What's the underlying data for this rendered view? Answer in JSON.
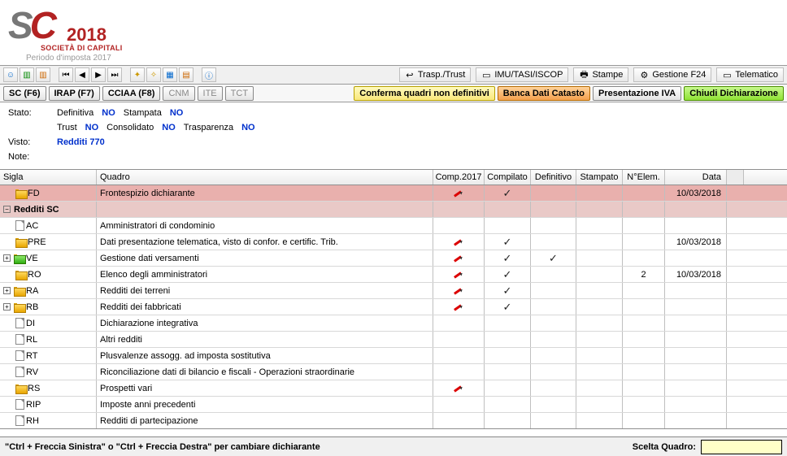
{
  "header": {
    "year": "2018",
    "subtitle": "SOCIETÀ DI CAPITALI",
    "period": "Periodo d'imposta 2017"
  },
  "toolbar1": {
    "trasp_trust": "Trasp./Trust",
    "imu": "IMU/TASI/ISCOP",
    "stampe": "Stampe",
    "gestione": "Gestione F24",
    "telematico": "Telematico"
  },
  "tabbar": {
    "sc": "SC (F6)",
    "irap": "IRAP (F7)",
    "cciaa": "CCIAA (F8)",
    "cnm": "CNM",
    "ite": "ITE",
    "tct": "TCT",
    "conferma": "Conferma quadri non definitivi",
    "banca": "Banca Dati Catasto",
    "pres_iva": "Presentazione IVA",
    "chiudi": "Chiudi Dichiarazione"
  },
  "info": {
    "stato_label": "Stato:",
    "definitiva": "Definitiva",
    "definitiva_v": "NO",
    "stampata": "Stampata",
    "stampata_v": "NO",
    "trust": "Trust",
    "trust_v": "NO",
    "consolidato": "Consolidato",
    "consolidato_v": "NO",
    "trasparenza": "Trasparenza",
    "trasparenza_v": "NO",
    "visto_label": "Visto:",
    "visto_v": "Redditi 770",
    "note_label": "Note:"
  },
  "columns": {
    "sigla": "Sigla",
    "quadro": "Quadro",
    "comp": "Comp.2017",
    "compilato": "Compilato",
    "definitivo": "Definitivo",
    "stampato": "Stampato",
    "nelem": "N°Elem.",
    "data": "Data"
  },
  "section_title": "Redditi SC",
  "rows": [
    {
      "type": "highlight",
      "exp": "",
      "icon": "folder",
      "sigla": "FD",
      "quadro": "Frontespizio dichiarante",
      "comp": true,
      "compilato": true,
      "def": false,
      "stamp": false,
      "nelem": "",
      "data": "10/03/2018"
    },
    {
      "type": "section",
      "label": "Redditi SC"
    },
    {
      "type": "row",
      "exp": "",
      "icon": "doc",
      "sigla": "AC",
      "quadro": "Amministratori di condominio",
      "comp": false,
      "compilato": false,
      "def": false,
      "stamp": false,
      "nelem": "",
      "data": ""
    },
    {
      "type": "row",
      "exp": "",
      "icon": "folder",
      "sigla": "PRE",
      "quadro": "Dati presentazione telematica, visto di confor. e certific. Trib.",
      "comp": true,
      "compilato": true,
      "def": false,
      "stamp": false,
      "nelem": "",
      "data": "10/03/2018"
    },
    {
      "type": "row",
      "exp": "+",
      "icon": "folder-green",
      "sigla": "VE",
      "quadro": "Gestione dati versamenti",
      "comp": true,
      "compilato": true,
      "def": true,
      "stamp": false,
      "nelem": "",
      "data": ""
    },
    {
      "type": "row",
      "exp": "",
      "icon": "folder",
      "sigla": "RO",
      "quadro": "Elenco degli amministratori",
      "comp": true,
      "compilato": true,
      "def": false,
      "stamp": false,
      "nelem": "2",
      "data": "10/03/2018"
    },
    {
      "type": "row",
      "exp": "+",
      "icon": "folder",
      "sigla": "RA",
      "quadro": "Redditi dei terreni",
      "comp": true,
      "compilato": true,
      "def": false,
      "stamp": false,
      "nelem": "",
      "data": ""
    },
    {
      "type": "row",
      "exp": "+",
      "icon": "folder",
      "sigla": "RB",
      "quadro": "Redditi dei fabbricati",
      "comp": true,
      "compilato": true,
      "def": false,
      "stamp": false,
      "nelem": "",
      "data": ""
    },
    {
      "type": "row",
      "exp": "",
      "icon": "doc",
      "sigla": "DI",
      "quadro": "Dichiarazione integrativa",
      "comp": false,
      "compilato": false,
      "def": false,
      "stamp": false,
      "nelem": "",
      "data": ""
    },
    {
      "type": "row",
      "exp": "",
      "icon": "doc",
      "sigla": "RL",
      "quadro": "Altri redditi",
      "comp": false,
      "compilato": false,
      "def": false,
      "stamp": false,
      "nelem": "",
      "data": ""
    },
    {
      "type": "row",
      "exp": "",
      "icon": "doc",
      "sigla": "RT",
      "quadro": "Plusvalenze assogg. ad imposta sostitutiva",
      "comp": false,
      "compilato": false,
      "def": false,
      "stamp": false,
      "nelem": "",
      "data": ""
    },
    {
      "type": "row",
      "exp": "",
      "icon": "doc",
      "sigla": "RV",
      "quadro": "Riconciliazione dati di bilancio e fiscali - Operazioni straordinarie",
      "comp": false,
      "compilato": false,
      "def": false,
      "stamp": false,
      "nelem": "",
      "data": ""
    },
    {
      "type": "row",
      "exp": "",
      "icon": "folder",
      "sigla": "RS",
      "quadro": "Prospetti vari",
      "comp": true,
      "compilato": false,
      "def": false,
      "stamp": false,
      "nelem": "",
      "data": ""
    },
    {
      "type": "row",
      "exp": "",
      "icon": "doc",
      "sigla": "RIP",
      "quadro": "Imposte anni precedenti",
      "comp": false,
      "compilato": false,
      "def": false,
      "stamp": false,
      "nelem": "",
      "data": ""
    },
    {
      "type": "row",
      "exp": "",
      "icon": "doc",
      "sigla": "RH",
      "quadro": "Redditi di partecipazione",
      "comp": false,
      "compilato": false,
      "def": false,
      "stamp": false,
      "nelem": "",
      "data": ""
    }
  ],
  "footer": {
    "hint": "\"Ctrl + Freccia Sinistra\" o \"Ctrl + Freccia Destra\" per cambiare dichiarante",
    "scelta_label": "Scelta Quadro:",
    "scelta_value": ""
  }
}
